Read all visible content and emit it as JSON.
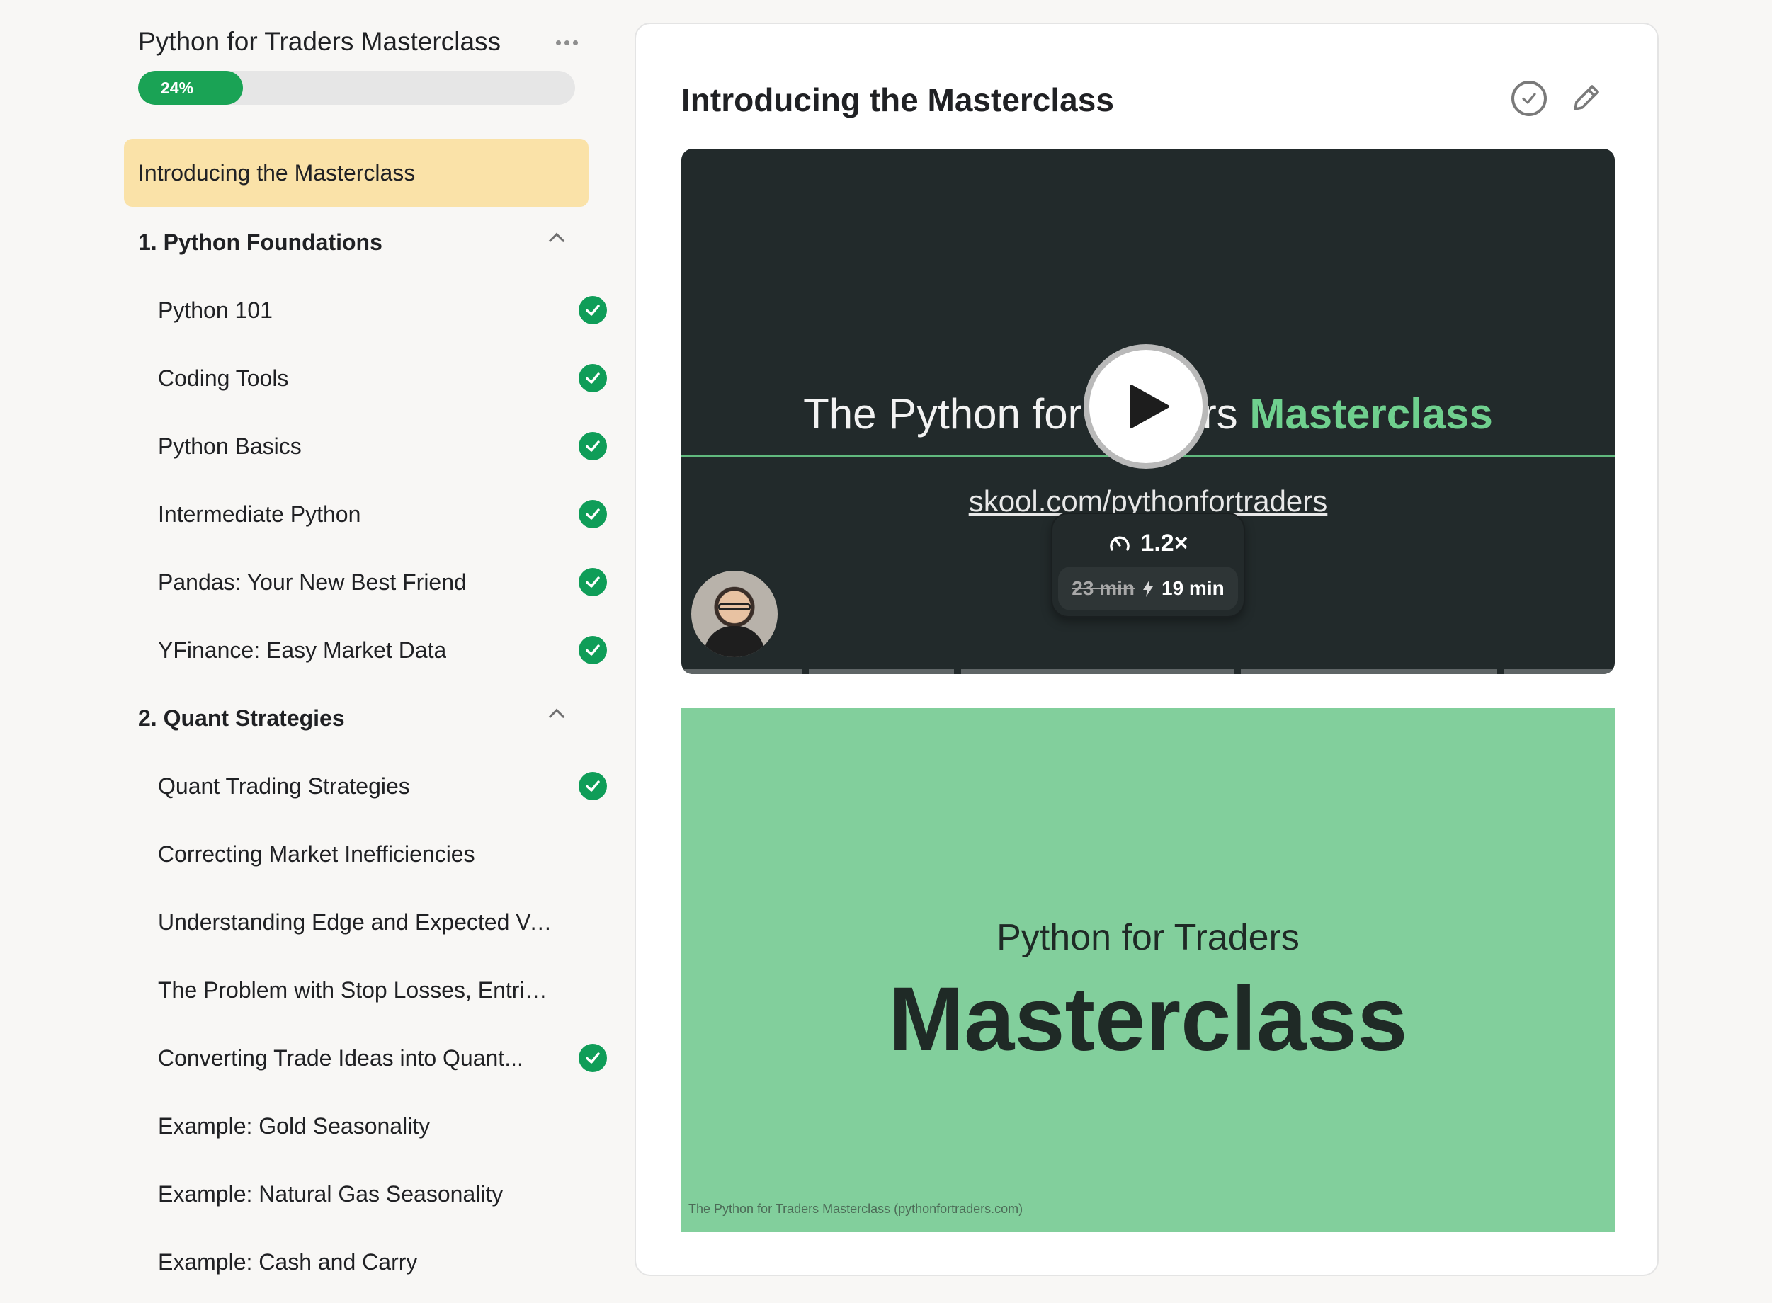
{
  "sidebar": {
    "course_title": "Python for Traders Masterclass",
    "progress": {
      "percent": 24,
      "label": "24%"
    },
    "active_lesson": "Introducing the Masterclass",
    "sections": [
      {
        "title": "1. Python Foundations",
        "lessons": [
          {
            "label": "Python 101",
            "completed": true
          },
          {
            "label": "Coding Tools",
            "completed": true
          },
          {
            "label": "Python Basics",
            "completed": true
          },
          {
            "label": "Intermediate Python",
            "completed": true
          },
          {
            "label": "Pandas: Your New Best Friend",
            "completed": true
          },
          {
            "label": "YFinance: Easy Market Data",
            "completed": true
          }
        ]
      },
      {
        "title": "2. Quant Strategies",
        "lessons": [
          {
            "label": "Quant Trading Strategies",
            "completed": true
          },
          {
            "label": "Correcting Market Inefficiencies",
            "completed": false
          },
          {
            "label": "Understanding Edge and Expected Value",
            "completed": false
          },
          {
            "label": "The Problem with Stop Losses, Entries, ...",
            "completed": false
          },
          {
            "label": "Converting Trade Ideas into Quant...",
            "completed": true
          },
          {
            "label": "Example: Gold Seasonality",
            "completed": false
          },
          {
            "label": "Example: Natural Gas Seasonality",
            "completed": false
          },
          {
            "label": "Example: Cash and Carry",
            "completed": false
          }
        ]
      }
    ]
  },
  "main": {
    "title": "Introducing the Masterclass",
    "video": {
      "title_prefix": "The Python for Traders ",
      "title_accent": "Masterclass",
      "url_text": "skool.com/pythonfortraders",
      "speed": "1.2×",
      "original_time": "23 min",
      "new_time": "19 min"
    },
    "slide": {
      "subtitle": "Python for Traders",
      "title": "Masterclass",
      "footer": "The Python for Traders Masterclass (pythonfortraders.com)"
    }
  },
  "colors": {
    "accent_green": "#1aa355",
    "active_highlight": "#fae2a8",
    "slide_green": "#82cf9c",
    "video_bg": "#222a2b"
  },
  "icons": {
    "more": "more-horizontal-icon",
    "collapse": "chevron-up-icon",
    "completed": "check-circle-icon",
    "mark_complete": "check-circle-outline-icon",
    "edit": "pencil-icon",
    "play": "play-icon",
    "speed": "speedometer-icon",
    "bolt": "lightning-icon"
  }
}
